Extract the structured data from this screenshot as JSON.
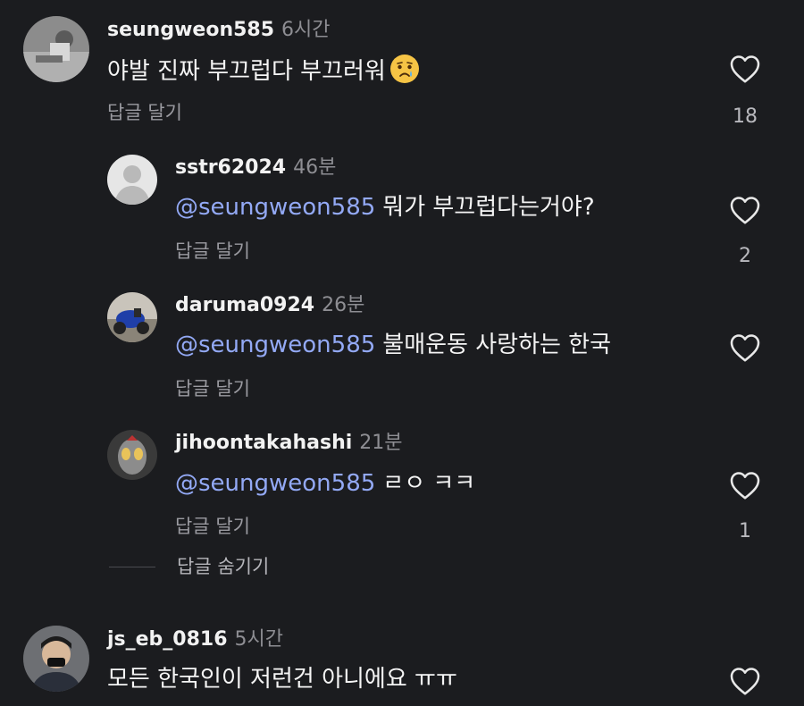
{
  "comments": [
    {
      "username": "seungweon585",
      "time": "6시간",
      "text": "야발 진짜 부끄럽다 부끄러워",
      "emoji": "crying-face",
      "reply_label": "답글 달기",
      "likes": "18"
    },
    {
      "username": "sstr62024",
      "time": "46분",
      "mention": "@seungweon585",
      "text": "뭐가 부끄럽다는거야?",
      "reply_label": "답글 달기",
      "likes": "2"
    },
    {
      "username": "daruma0924",
      "time": "26분",
      "mention": "@seungweon585",
      "text": "불매운동 사랑하는 한국",
      "reply_label": "답글 달기",
      "likes": ""
    },
    {
      "username": "jihoontakahashi",
      "time": "21분",
      "mention": "@seungweon585",
      "text": "ㄹㅇ ㅋㅋ",
      "reply_label": "답글 달기",
      "likes": "1"
    },
    {
      "username": "js_eb_0816",
      "time": "5시간",
      "text": "모든 한국인이 저런건 아니에요 ㅠㅠ",
      "likes": ""
    }
  ],
  "hide_replies_label": "답글 숨기기",
  "colors": {
    "background": "#1b1c1f",
    "mention": "#93a9f5",
    "muted": "#8e8e93"
  },
  "icons": {
    "like": "heart-outline-icon",
    "emoji": "crying-face"
  }
}
